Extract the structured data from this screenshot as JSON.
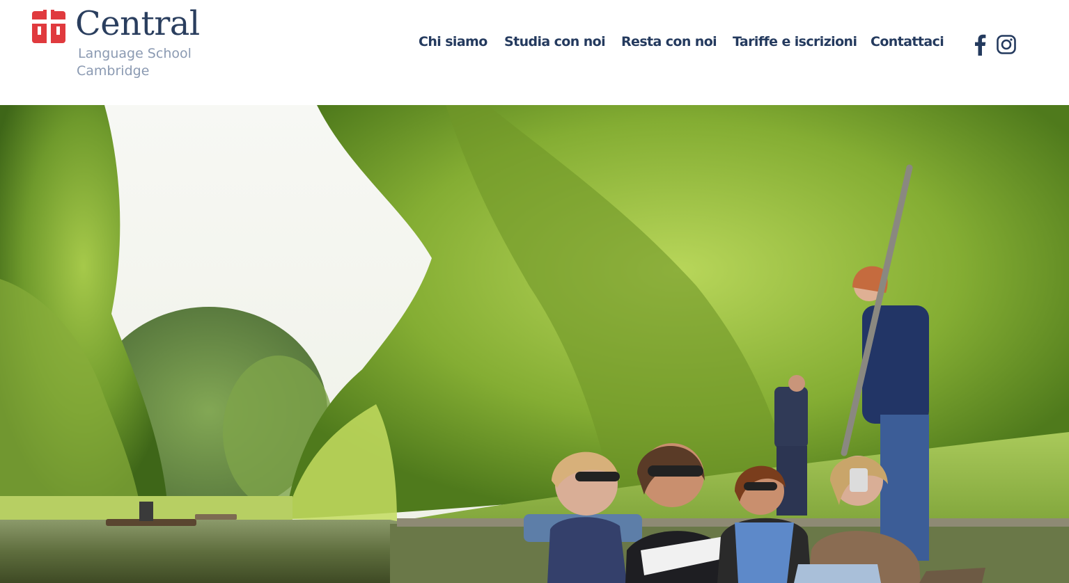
{
  "brand": {
    "name": "Central",
    "subtitle_line1": "Language School",
    "subtitle_line2": "Cambridge",
    "colors": {
      "logo_red": "#e03a3e",
      "logo_navy": "#2a3e5e",
      "logo_gray": "#8b9ab2",
      "nav_text": "#243a5e"
    }
  },
  "nav": {
    "items": [
      {
        "label": "Chi siamo"
      },
      {
        "label": "Studia con noi"
      },
      {
        "label": "Resta con noi"
      },
      {
        "label": "Tariffe e iscrizioni"
      },
      {
        "label": "Contattaci"
      }
    ]
  },
  "social": {
    "icons": [
      "facebook-icon",
      "instagram-icon"
    ]
  },
  "hero": {
    "image": "photo of people punting on the river Cam under willow trees"
  }
}
